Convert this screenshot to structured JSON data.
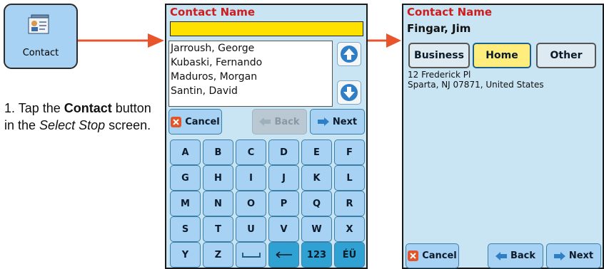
{
  "tile": {
    "label": "Contact",
    "icon": "contact-card-icon"
  },
  "instruction": {
    "prefix": "1. Tap the ",
    "bold": "Contact",
    "mid": " button in the ",
    "italic": "Select Stop",
    "suffix": " screen."
  },
  "screen1": {
    "title": "Contact Name",
    "search_value": "",
    "contacts": [
      "Jarroush, George",
      "Kubaski, Fernando",
      "Maduros, Morgan",
      "Santin, David"
    ],
    "cancel_label": "Cancel",
    "back_label": "Back",
    "next_label": "Next",
    "keys": [
      [
        "A",
        "B",
        "C",
        "D",
        "E",
        "F"
      ],
      [
        "G",
        "H",
        "I",
        "J",
        "K",
        "L"
      ],
      [
        "M",
        "N",
        "O",
        "P",
        "Q",
        "R"
      ],
      [
        "S",
        "T",
        "U",
        "V",
        "W",
        "X"
      ],
      [
        "Y",
        "Z",
        "",
        "",
        "123",
        "ÉÜ"
      ]
    ]
  },
  "screen2": {
    "title": "Contact Name",
    "contact_name": "Fingar, Jim",
    "tabs": {
      "business": "Business",
      "home": "Home",
      "other": "Other"
    },
    "selected_tab": "Home",
    "address_line1": "12 Frederick Pl",
    "address_line2": "Sparta, NJ 07871, United States",
    "cancel_label": "Cancel",
    "back_label": "Back",
    "next_label": "Next"
  },
  "colors": {
    "screen_bg": "#c9e4f2",
    "button": "#a8d2f3",
    "title": "#cc1e1e",
    "search_field": "#ffe100",
    "arrow": "#e8542b",
    "selected_tab": "#ffee7e"
  }
}
